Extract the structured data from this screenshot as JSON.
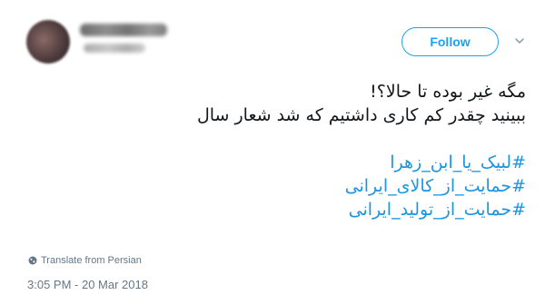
{
  "header": {
    "follow_label": "Follow"
  },
  "tweet": {
    "lines": [
      "مگه غیر بوده تا حالا؟!",
      "ببینید چقدر کم کاری داشتیم که شد شعار سال"
    ],
    "hashtags": [
      "#لبیک_یا_ابن_زهرا",
      "#حمایت_از_کالای_ایرانی",
      "#حمایت_از_تولید_ایرانی"
    ]
  },
  "footer": {
    "translate_label": "Translate from Persian",
    "timestamp": "3:05 PM - 20 Mar 2018"
  },
  "colors": {
    "accent": "#1DA1F2",
    "hashtag": "#1b95e0",
    "text": "#14171a",
    "muted": "#657786"
  },
  "icons": {
    "globe": "globe-icon",
    "caret": "chevron-down-icon"
  }
}
